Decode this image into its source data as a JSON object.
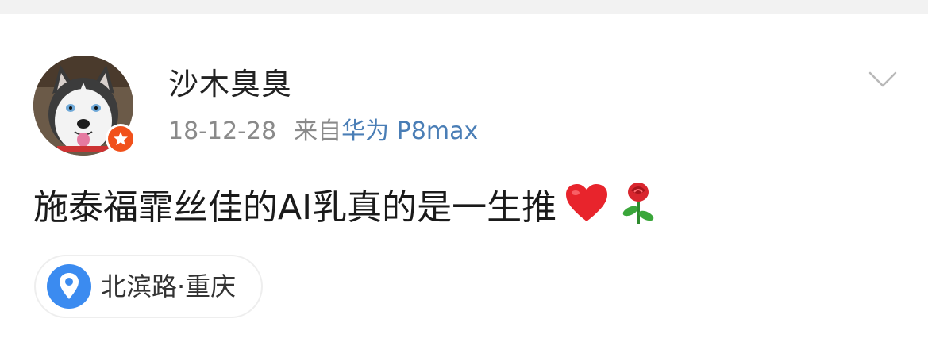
{
  "post": {
    "username": "沙木臭臭",
    "date": "18-12-28",
    "source_prefix": "来自",
    "device": "华为 P8max",
    "text": "施泰福霏丝佳的AI乳真的是一生推",
    "emojis": [
      "heart-emoji",
      "rose-emoji"
    ],
    "location": "北滨路·重庆"
  },
  "colors": {
    "link_blue": "#4a7eb6",
    "badge_orange": "#f1511b",
    "pin_blue": "#3b8bf0",
    "meta_gray": "#8a8a8a"
  },
  "icons": {
    "avatar": "husky-avatar",
    "badge": "verified-star-icon",
    "menu": "chevron-down-icon",
    "location": "location-pin-icon"
  }
}
